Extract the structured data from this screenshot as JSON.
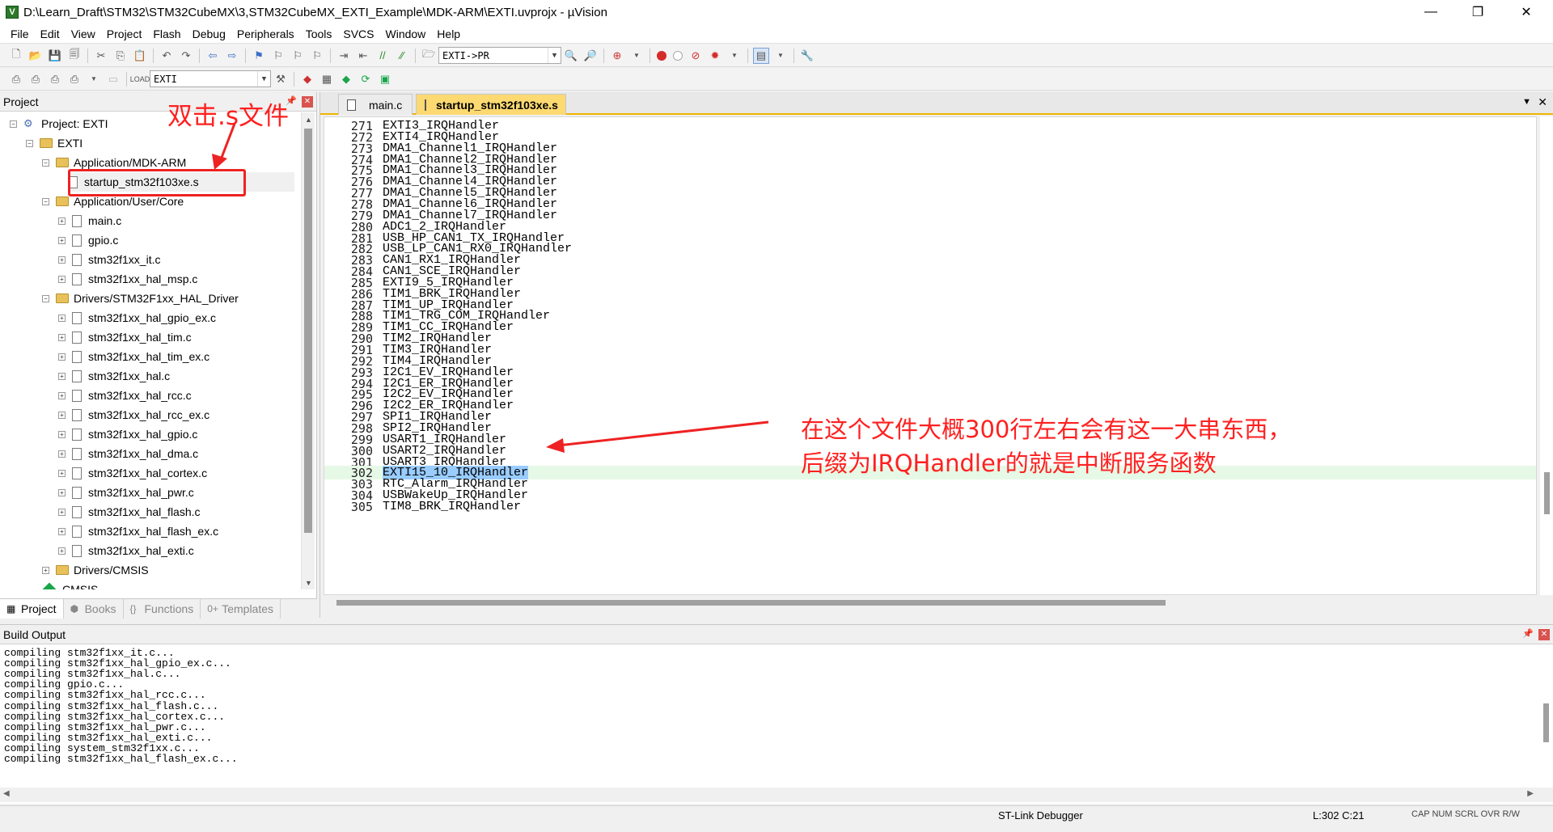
{
  "window": {
    "title": "D:\\Learn_Draft\\STM32\\STM32CubeMX\\3,STM32CubeMX_EXTI_Example\\MDK-ARM\\EXTI.uvprojx - µVision",
    "app_icon": "V"
  },
  "menu": [
    "File",
    "Edit",
    "View",
    "Project",
    "Flash",
    "Debug",
    "Peripherals",
    "Tools",
    "SVCS",
    "Window",
    "Help"
  ],
  "toolbar": {
    "find_combo_value": "EXTI->PR",
    "target_combo_value": "EXTI"
  },
  "project_pane": {
    "title": "Project",
    "tree": [
      {
        "label": "Project: EXTI",
        "level": 0,
        "kind": "project",
        "expander": "−"
      },
      {
        "label": "EXTI",
        "level": 1,
        "kind": "target",
        "expander": "−"
      },
      {
        "label": "Application/MDK-ARM",
        "level": 2,
        "kind": "folder",
        "expander": "−"
      },
      {
        "label": "startup_stm32f103xe.s",
        "level": 3,
        "kind": "file",
        "expander": ""
      },
      {
        "label": "Application/User/Core",
        "level": 2,
        "kind": "folder",
        "expander": "−"
      },
      {
        "label": "main.c",
        "level": 3,
        "kind": "file",
        "expander": "+"
      },
      {
        "label": "gpio.c",
        "level": 3,
        "kind": "file",
        "expander": "+"
      },
      {
        "label": "stm32f1xx_it.c",
        "level": 3,
        "kind": "file",
        "expander": "+"
      },
      {
        "label": "stm32f1xx_hal_msp.c",
        "level": 3,
        "kind": "file",
        "expander": "+"
      },
      {
        "label": "Drivers/STM32F1xx_HAL_Driver",
        "level": 2,
        "kind": "folder",
        "expander": "−"
      },
      {
        "label": "stm32f1xx_hal_gpio_ex.c",
        "level": 3,
        "kind": "file",
        "expander": "+"
      },
      {
        "label": "stm32f1xx_hal_tim.c",
        "level": 3,
        "kind": "file",
        "expander": "+"
      },
      {
        "label": "stm32f1xx_hal_tim_ex.c",
        "level": 3,
        "kind": "file",
        "expander": "+"
      },
      {
        "label": "stm32f1xx_hal.c",
        "level": 3,
        "kind": "file",
        "expander": "+"
      },
      {
        "label": "stm32f1xx_hal_rcc.c",
        "level": 3,
        "kind": "file",
        "expander": "+"
      },
      {
        "label": "stm32f1xx_hal_rcc_ex.c",
        "level": 3,
        "kind": "file",
        "expander": "+"
      },
      {
        "label": "stm32f1xx_hal_gpio.c",
        "level": 3,
        "kind": "file",
        "expander": "+"
      },
      {
        "label": "stm32f1xx_hal_dma.c",
        "level": 3,
        "kind": "file",
        "expander": "+"
      },
      {
        "label": "stm32f1xx_hal_cortex.c",
        "level": 3,
        "kind": "file",
        "expander": "+"
      },
      {
        "label": "stm32f1xx_hal_pwr.c",
        "level": 3,
        "kind": "file",
        "expander": "+"
      },
      {
        "label": "stm32f1xx_hal_flash.c",
        "level": 3,
        "kind": "file",
        "expander": "+"
      },
      {
        "label": "stm32f1xx_hal_flash_ex.c",
        "level": 3,
        "kind": "file",
        "expander": "+"
      },
      {
        "label": "stm32f1xx_hal_exti.c",
        "level": 3,
        "kind": "file",
        "expander": "+"
      },
      {
        "label": "Drivers/CMSIS",
        "level": 2,
        "kind": "folder",
        "expander": "+"
      },
      {
        "label": "CMSIS",
        "level": 2,
        "kind": "cmsis",
        "expander": ""
      }
    ],
    "bottom_tabs": [
      "Project",
      "Books",
      "Functions",
      "Templates"
    ]
  },
  "annotations": {
    "double_click_note": "双击.s文件",
    "note_line1": "在这个文件大概300行左右会有这一大串东西，",
    "note_line2": "后缀为IRQHandler的就是中断服务函数",
    "color": "#ff2020"
  },
  "editor": {
    "tabs": [
      {
        "label": "main.c",
        "active": false
      },
      {
        "label": "startup_stm32f103xe.s",
        "active": true
      }
    ],
    "lines": [
      {
        "n": "271",
        "text": "EXTI3_IRQHandler"
      },
      {
        "n": "272",
        "text": "EXTI4_IRQHandler"
      },
      {
        "n": "273",
        "text": "DMA1_Channel1_IRQHandler"
      },
      {
        "n": "274",
        "text": "DMA1_Channel2_IRQHandler"
      },
      {
        "n": "275",
        "text": "DMA1_Channel3_IRQHandler"
      },
      {
        "n": "276",
        "text": "DMA1_Channel4_IRQHandler"
      },
      {
        "n": "277",
        "text": "DMA1_Channel5_IRQHandler"
      },
      {
        "n": "278",
        "text": "DMA1_Channel6_IRQHandler"
      },
      {
        "n": "279",
        "text": "DMA1_Channel7_IRQHandler"
      },
      {
        "n": "280",
        "text": "ADC1_2_IRQHandler"
      },
      {
        "n": "281",
        "text": "USB_HP_CAN1_TX_IRQHandler"
      },
      {
        "n": "282",
        "text": "USB_LP_CAN1_RX0_IRQHandler"
      },
      {
        "n": "283",
        "text": "CAN1_RX1_IRQHandler"
      },
      {
        "n": "284",
        "text": "CAN1_SCE_IRQHandler"
      },
      {
        "n": "285",
        "text": "EXTI9_5_IRQHandler"
      },
      {
        "n": "286",
        "text": "TIM1_BRK_IRQHandler"
      },
      {
        "n": "287",
        "text": "TIM1_UP_IRQHandler"
      },
      {
        "n": "288",
        "text": "TIM1_TRG_COM_IRQHandler"
      },
      {
        "n": "289",
        "text": "TIM1_CC_IRQHandler"
      },
      {
        "n": "290",
        "text": "TIM2_IRQHandler"
      },
      {
        "n": "291",
        "text": "TIM3_IRQHandler"
      },
      {
        "n": "292",
        "text": "TIM4_IRQHandler"
      },
      {
        "n": "293",
        "text": "I2C1_EV_IRQHandler"
      },
      {
        "n": "294",
        "text": "I2C1_ER_IRQHandler"
      },
      {
        "n": "295",
        "text": "I2C2_EV_IRQHandler"
      },
      {
        "n": "296",
        "text": "I2C2_ER_IRQHandler"
      },
      {
        "n": "297",
        "text": "SPI1_IRQHandler"
      },
      {
        "n": "298",
        "text": "SPI2_IRQHandler"
      },
      {
        "n": "299",
        "text": "USART1_IRQHandler"
      },
      {
        "n": "300",
        "text": "USART2_IRQHandler"
      },
      {
        "n": "301",
        "text": "USART3_IRQHandler"
      },
      {
        "n": "302",
        "text": "EXTI15_10_IRQHandler",
        "current": true
      },
      {
        "n": "303",
        "text": "RTC_Alarm_IRQHandler"
      },
      {
        "n": "304",
        "text": "USBWakeUp_IRQHandler"
      },
      {
        "n": "305",
        "text": "TIM8_BRK_IRQHandler"
      }
    ]
  },
  "build_output": {
    "title": "Build Output",
    "lines": [
      "compiling stm32f1xx_it.c...",
      "compiling stm32f1xx_hal_gpio_ex.c...",
      "compiling stm32f1xx_hal.c...",
      "compiling gpio.c...",
      "compiling stm32f1xx_hal_rcc.c...",
      "compiling stm32f1xx_hal_flash.c...",
      "compiling stm32f1xx_hal_cortex.c...",
      "compiling stm32f1xx_hal_pwr.c...",
      "compiling stm32f1xx_hal_exti.c...",
      "compiling system_stm32f1xx.c...",
      "compiling stm32f1xx_hal_flash_ex.c..."
    ]
  },
  "status": {
    "debugger": "ST-Link Debugger",
    "position": "L:302 C:21",
    "indicators": "CAP NUM SCRL OVR R/W"
  }
}
